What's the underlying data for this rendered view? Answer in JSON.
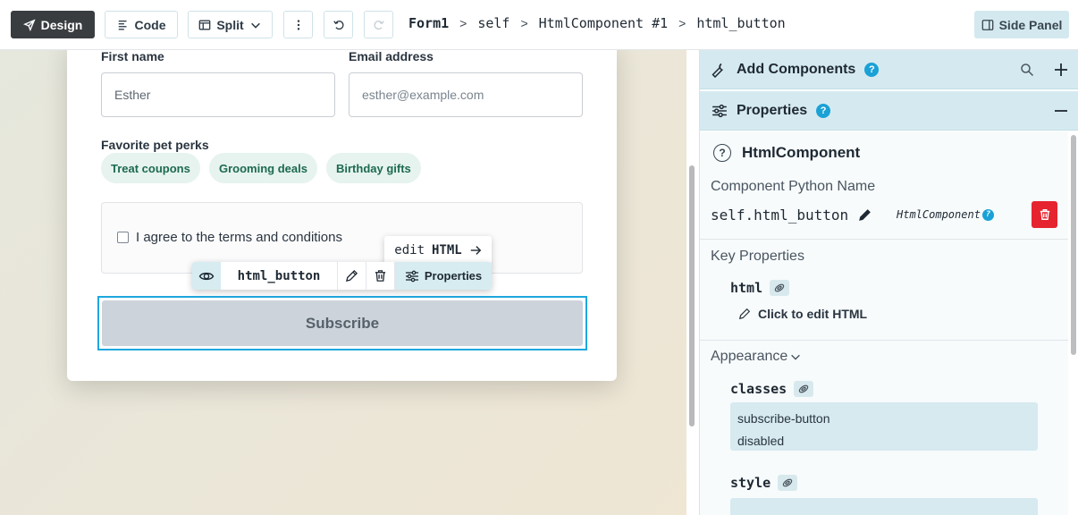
{
  "toolbar": {
    "design_label": "Design",
    "code_label": "Code",
    "split_label": "Split",
    "breadcrumb": [
      "Form1",
      "self",
      "HtmlComponent #1",
      "html_button"
    ],
    "side_panel_label": "Side Panel"
  },
  "form": {
    "first_name_label": "First name",
    "first_name_value": "Esther",
    "email_label": "Email address",
    "email_placeholder": "esther@example.com",
    "perks_label": "Favorite pet perks",
    "perks": [
      "Treat coupons",
      "Grooming deals",
      "Birthday gifts"
    ],
    "terms_label": "I agree to the terms and conditions",
    "subscribe_label": "Subscribe"
  },
  "widget_toolbar": {
    "edit_html_prefix": "edit",
    "edit_html_label": "HTML",
    "component_name": "html_button",
    "properties_label": "Properties"
  },
  "panel": {
    "add_components_label": "Add Components",
    "properties_label": "Properties",
    "component_title": "HtmlComponent",
    "python_name_label": "Component Python Name",
    "python_name_value": "self.html_button",
    "component_type": "HtmlComponent",
    "key_properties_label": "Key Properties",
    "html_prop": "html",
    "edit_html_link": "Click to edit HTML",
    "appearance_label": "Appearance",
    "classes_prop": "classes",
    "classes_values": [
      "subscribe-button",
      "disabled"
    ],
    "style_prop": "style"
  },
  "colors": {
    "accent": "#1aa1d6",
    "panel_header": "#d5eaf0",
    "delete": "#e5242f",
    "chip_text": "#1d6a4f"
  }
}
